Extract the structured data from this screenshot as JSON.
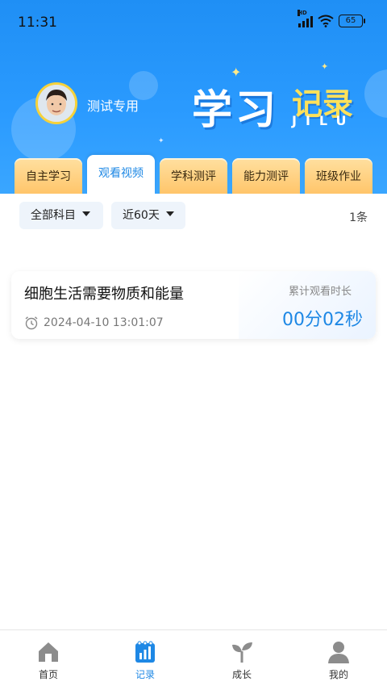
{
  "status_bar": {
    "time": "11:31",
    "network": "HD",
    "battery": "65"
  },
  "header": {
    "username": "测试专用",
    "title_main": "学习",
    "title_sub": "记录",
    "title_pinyin": "JILU"
  },
  "tabs": [
    {
      "label": "自主学习",
      "active": false
    },
    {
      "label": "观看视频",
      "active": true
    },
    {
      "label": "学科测评",
      "active": false
    },
    {
      "label": "能力测评",
      "active": false
    },
    {
      "label": "班级作业",
      "active": false
    }
  ],
  "filters": {
    "subject": "全部科目",
    "period": "近60天",
    "count": "1条"
  },
  "records": [
    {
      "title": "细胞生活需要物质和能量",
      "time": "2024-04-10 13:01:07",
      "duration_label": "累计观看时长",
      "duration": "00分02秒"
    }
  ],
  "bottom_nav": [
    {
      "label": "首页",
      "icon": "home-icon"
    },
    {
      "label": "记录",
      "icon": "records-chart-icon"
    },
    {
      "label": "成长",
      "icon": "sprout-icon"
    },
    {
      "label": "我的",
      "icon": "user-icon"
    }
  ],
  "colors": {
    "primary": "#1e88e5",
    "header_blue": "#2b9bff",
    "tab_gold": "#ffc56a",
    "title_yellow": "#ffe15a"
  }
}
